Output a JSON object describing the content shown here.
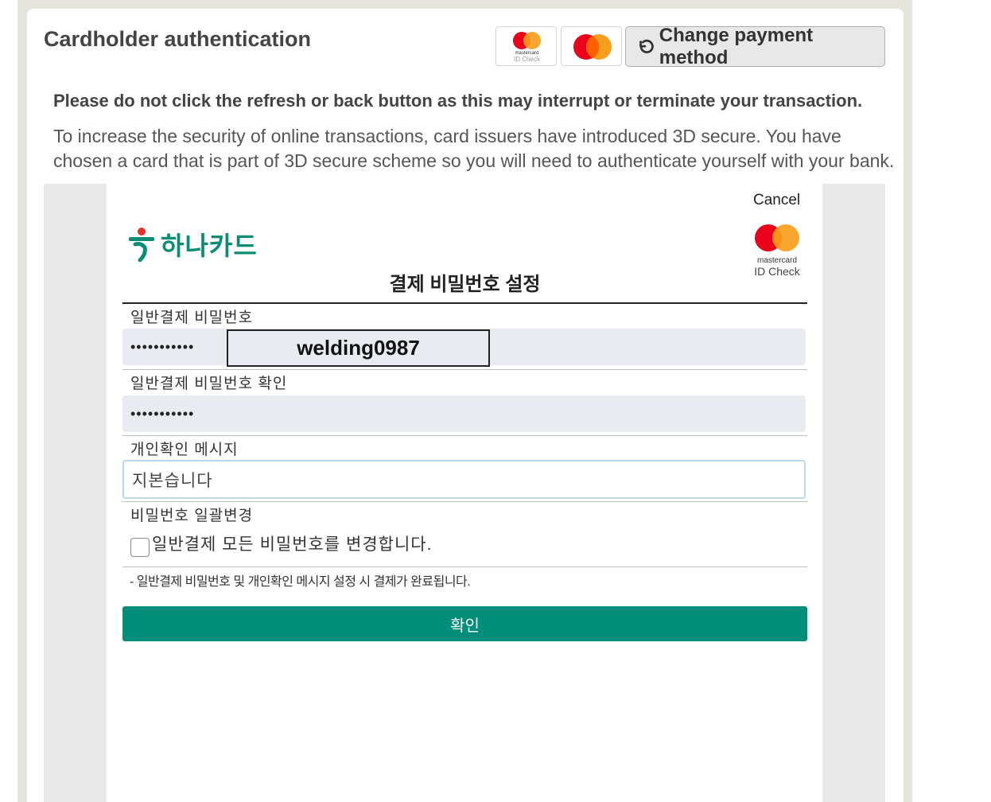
{
  "header": {
    "title": "Cardholder authentication",
    "change_payment_label": "Change payment method",
    "mc_small_word": "mastercard",
    "mc_small_id": "ID Check"
  },
  "warning": "Please do not click the refresh or back button as this may interrupt or terminate your transaction.",
  "info": "To increase the security of online transactions, card issuers have introduced 3D secure. You have chosen a card that is part of 3D secure scheme so you will need to authenticate yourself with your bank.",
  "bank_frame": {
    "cancel_label": "Cancel",
    "bank_name": "하나카드",
    "mc_word": "mastercard",
    "mc_id_check": "ID Check",
    "form_title": "결제 비밀번호 설정",
    "fields": {
      "password_label": "일반결제 비밀번호",
      "password_value": "•••••••••••",
      "password_confirm_label": "일반결제 비밀번호 확인",
      "password_confirm_value": "•••••••••••",
      "message_label": "개인확인 메시지",
      "message_value": "지본습니다",
      "bulk_change_label": "비밀번호 일괄변경",
      "bulk_change_checkbox_label": "일반결제 모든 비밀번호를 변경합니다."
    },
    "overlay_text": "welding0987",
    "note": "- 일반결제 비밀번호 및 개인확인 메시지 설정 시 결제가 완료됩니다.",
    "confirm_label": "확인"
  },
  "colors": {
    "page_bg": "#e6e4df",
    "hana_green": "#0b8d75",
    "confirm_button": "#008e7a",
    "mc_red": "#eb001b",
    "mc_orange": "#f79e1b",
    "hana_red": "#e4322b"
  }
}
